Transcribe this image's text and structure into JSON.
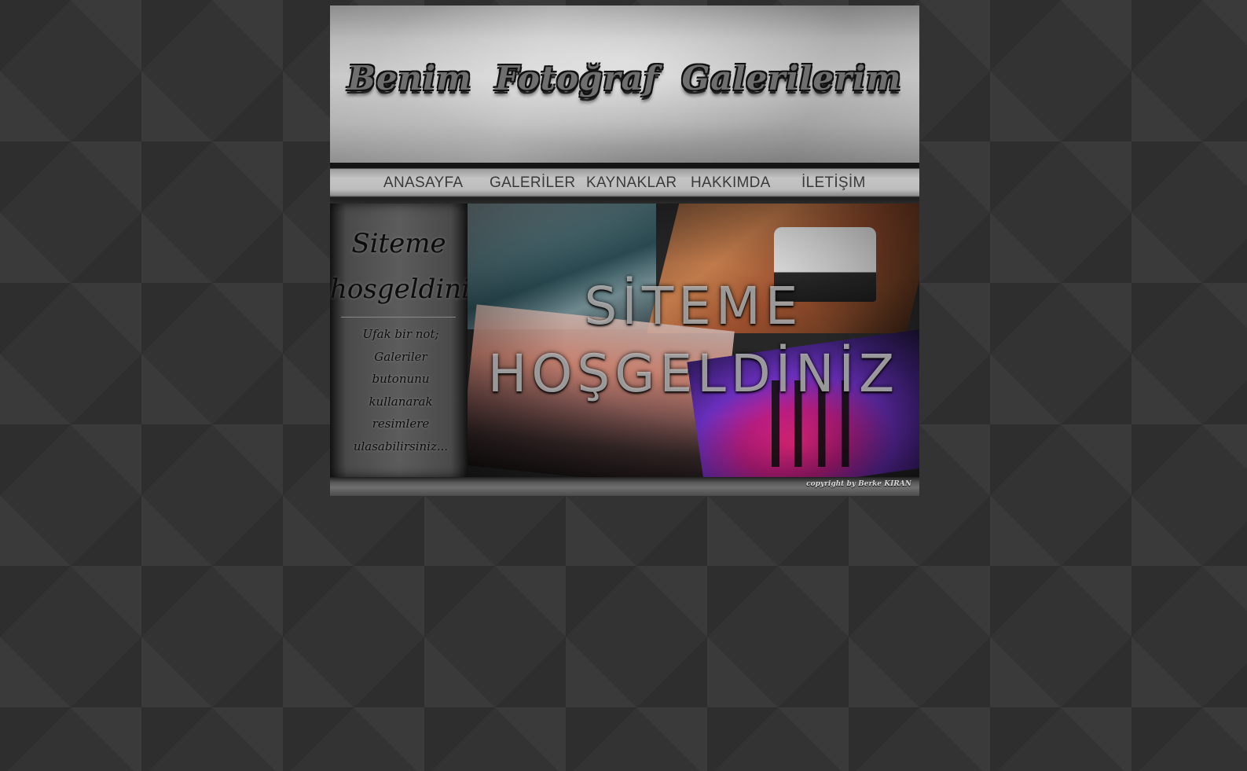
{
  "header": {
    "title": "Benim Fotoğraf Galerilerim"
  },
  "nav": {
    "items": [
      {
        "label": "ANASAYFA"
      },
      {
        "label": "GALERİLER"
      },
      {
        "label": "KAYNAKLAR"
      },
      {
        "label": "HAKKIMDA"
      },
      {
        "label": "İLETİŞİM"
      }
    ]
  },
  "sidebar": {
    "heading_line1": "Siteme",
    "heading_line2": "hosgeldiniz",
    "note_lines": [
      "Ufak bir not;",
      "Galeriler",
      "butonunu",
      "kullanarak",
      "resimlere",
      "ulasabilirsiniz..."
    ]
  },
  "banner": {
    "line1": "SİTEME",
    "line2": "HOŞGELDİNİZ"
  },
  "footer": {
    "copyright": "copyright by Berke KIRAN"
  },
  "colors": {
    "page_background": "#333333",
    "header": "#b8b8b8",
    "nav_text": "#3a3a3a",
    "accent_concert": "#c51e87"
  }
}
